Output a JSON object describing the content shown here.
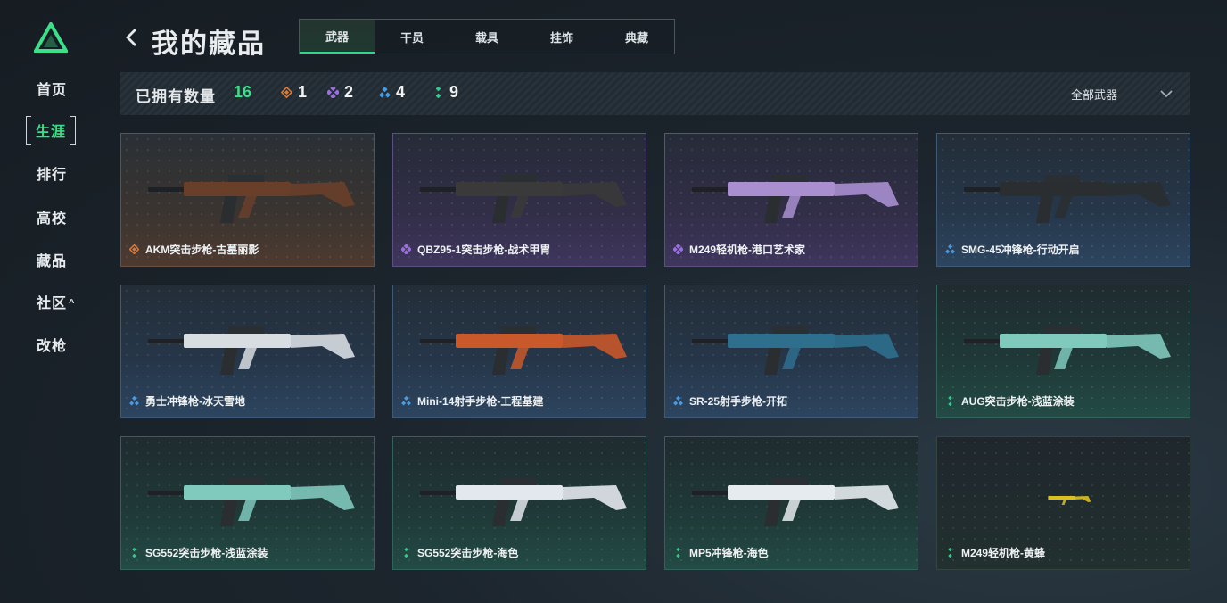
{
  "sidebar": {
    "logo": "triangle-logo",
    "items": [
      {
        "label": "首页"
      },
      {
        "label": "生涯"
      },
      {
        "label": "排行"
      },
      {
        "label": "高校"
      },
      {
        "label": "藏品"
      },
      {
        "label": "社区",
        "caret": "^"
      },
      {
        "label": "改枪"
      }
    ]
  },
  "header": {
    "title": "我的藏品",
    "tabs": [
      {
        "label": "武器"
      },
      {
        "label": "干员"
      },
      {
        "label": "载具"
      },
      {
        "label": "挂饰"
      },
      {
        "label": "典藏"
      }
    ]
  },
  "stats": {
    "owned_label": "已拥有数量",
    "owned_count": "16",
    "rarities": [
      {
        "icon": "orange-diamond-icon",
        "count": "1",
        "color": "#d9783a"
      },
      {
        "icon": "purple-diamond-icon",
        "count": "2",
        "color": "#9a6fe0"
      },
      {
        "icon": "blue-diamond-icon",
        "count": "4",
        "color": "#4a9be0"
      },
      {
        "icon": "green-diamond-icon",
        "count": "9",
        "color": "#35c98a"
      }
    ],
    "filter_label": "全部武器"
  },
  "cards": [
    {
      "name": "AKM突击步枪-古墓丽影",
      "rarity": "orange",
      "gun_color": "#6a3f2a"
    },
    {
      "name": "QBZ95-1突击步枪-战术甲胄",
      "rarity": "purple",
      "gun_color": "#3a3a3a"
    },
    {
      "name": "M249轻机枪-港口艺术家",
      "rarity": "purple",
      "gun_color": "#a98fd0"
    },
    {
      "name": "SMG-45冲锋枪-行动开启",
      "rarity": "blue",
      "gun_color": "#2a2e30"
    },
    {
      "name": "勇士冲锋枪-冰天雪地",
      "rarity": "blue",
      "gun_color": "#d8dde2"
    },
    {
      "name": "Mini-14射手步枪-工程基建",
      "rarity": "blue",
      "gun_color": "#c9582a"
    },
    {
      "name": "SR-25射手步枪-开拓",
      "rarity": "blue",
      "gun_color": "#2e6f8e"
    },
    {
      "name": "AUG突击步枪-浅蓝涂装",
      "rarity": "green",
      "gun_color": "#7fc9bd"
    },
    {
      "name": "SG552突击步枪-浅蓝涂装",
      "rarity": "green",
      "gun_color": "#7fc9bd"
    },
    {
      "name": "SG552突击步枪-海色",
      "rarity": "green",
      "gun_color": "#e3e8ee"
    },
    {
      "name": "MP5冲锋枪-海色",
      "rarity": "green",
      "gun_color": "#e6ebf0"
    },
    {
      "name": "M249轻机枪-黄蜂",
      "rarity": "green",
      "gun_color": "#d9c21e"
    }
  ]
}
